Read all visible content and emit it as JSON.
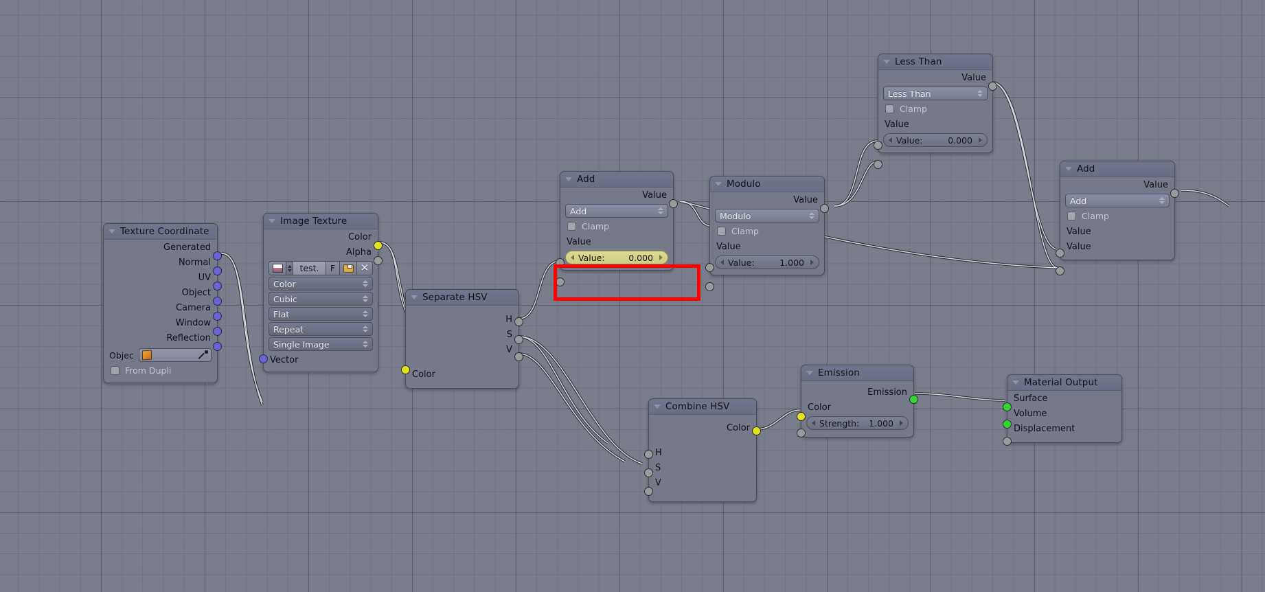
{
  "app": {
    "editor": "blender-node-editor",
    "background_color": "#7a7d8c",
    "highlight_color": "#ff0000"
  },
  "nodes": {
    "texture_coordinate": {
      "title": "Texture Coordinate",
      "outputs": [
        "Generated",
        "Normal",
        "UV",
        "Object",
        "Camera",
        "Window",
        "Reflection"
      ],
      "object_label": "Objec",
      "object_value": "",
      "from_dupli_label": "From Dupli",
      "from_dupli_checked": false
    },
    "image_texture": {
      "title": "Image Texture",
      "outputs": [
        "Color",
        "Alpha"
      ],
      "image_name": "test.",
      "fake_user_label": "F",
      "dropdowns": [
        "Color",
        "Cubic",
        "Flat",
        "Repeat",
        "Single Image"
      ],
      "inputs": [
        "Vector"
      ],
      "icons": {
        "image": "image-datablock-icon",
        "browse": "browse-image-icon",
        "open": "open-folder-icon",
        "unlink": "unlink-x-icon"
      }
    },
    "separate_hsv": {
      "title": "Separate HSV",
      "outputs": [
        "H",
        "S",
        "V"
      ],
      "inputs": [
        "Color"
      ]
    },
    "add_1": {
      "title": "Add",
      "outputs": [
        "Value"
      ],
      "operation": "Add",
      "clamp_label": "Clamp",
      "clamp_checked": false,
      "input_label": "Value",
      "value_field_label": "Value:",
      "value_field_value": "0.000",
      "highlighted": true
    },
    "modulo": {
      "title": "Modulo",
      "outputs": [
        "Value"
      ],
      "operation": "Modulo",
      "clamp_label": "Clamp",
      "clamp_checked": false,
      "input_label": "Value",
      "value_field_label": "Value:",
      "value_field_value": "1.000"
    },
    "less_than": {
      "title": "Less Than",
      "outputs": [
        "Value"
      ],
      "operation": "Less Than",
      "clamp_label": "Clamp",
      "clamp_checked": false,
      "input_label": "Value",
      "value_field_label": "Value:",
      "value_field_value": "0.000"
    },
    "add_2": {
      "title": "Add",
      "outputs": [
        "Value"
      ],
      "operation": "Add",
      "clamp_label": "Clamp",
      "clamp_checked": false,
      "input_label_1": "Value",
      "input_label_2": "Value"
    },
    "combine_hsv": {
      "title": "Combine HSV",
      "outputs": [
        "Color"
      ],
      "inputs": [
        "H",
        "S",
        "V"
      ]
    },
    "emission": {
      "title": "Emission",
      "outputs": [
        "Emission"
      ],
      "inputs": [
        "Color"
      ],
      "strength_label": "Strength:",
      "strength_value": "1.000"
    },
    "material_output": {
      "title": "Material Output",
      "inputs": [
        "Surface",
        "Volume",
        "Displacement"
      ]
    }
  }
}
